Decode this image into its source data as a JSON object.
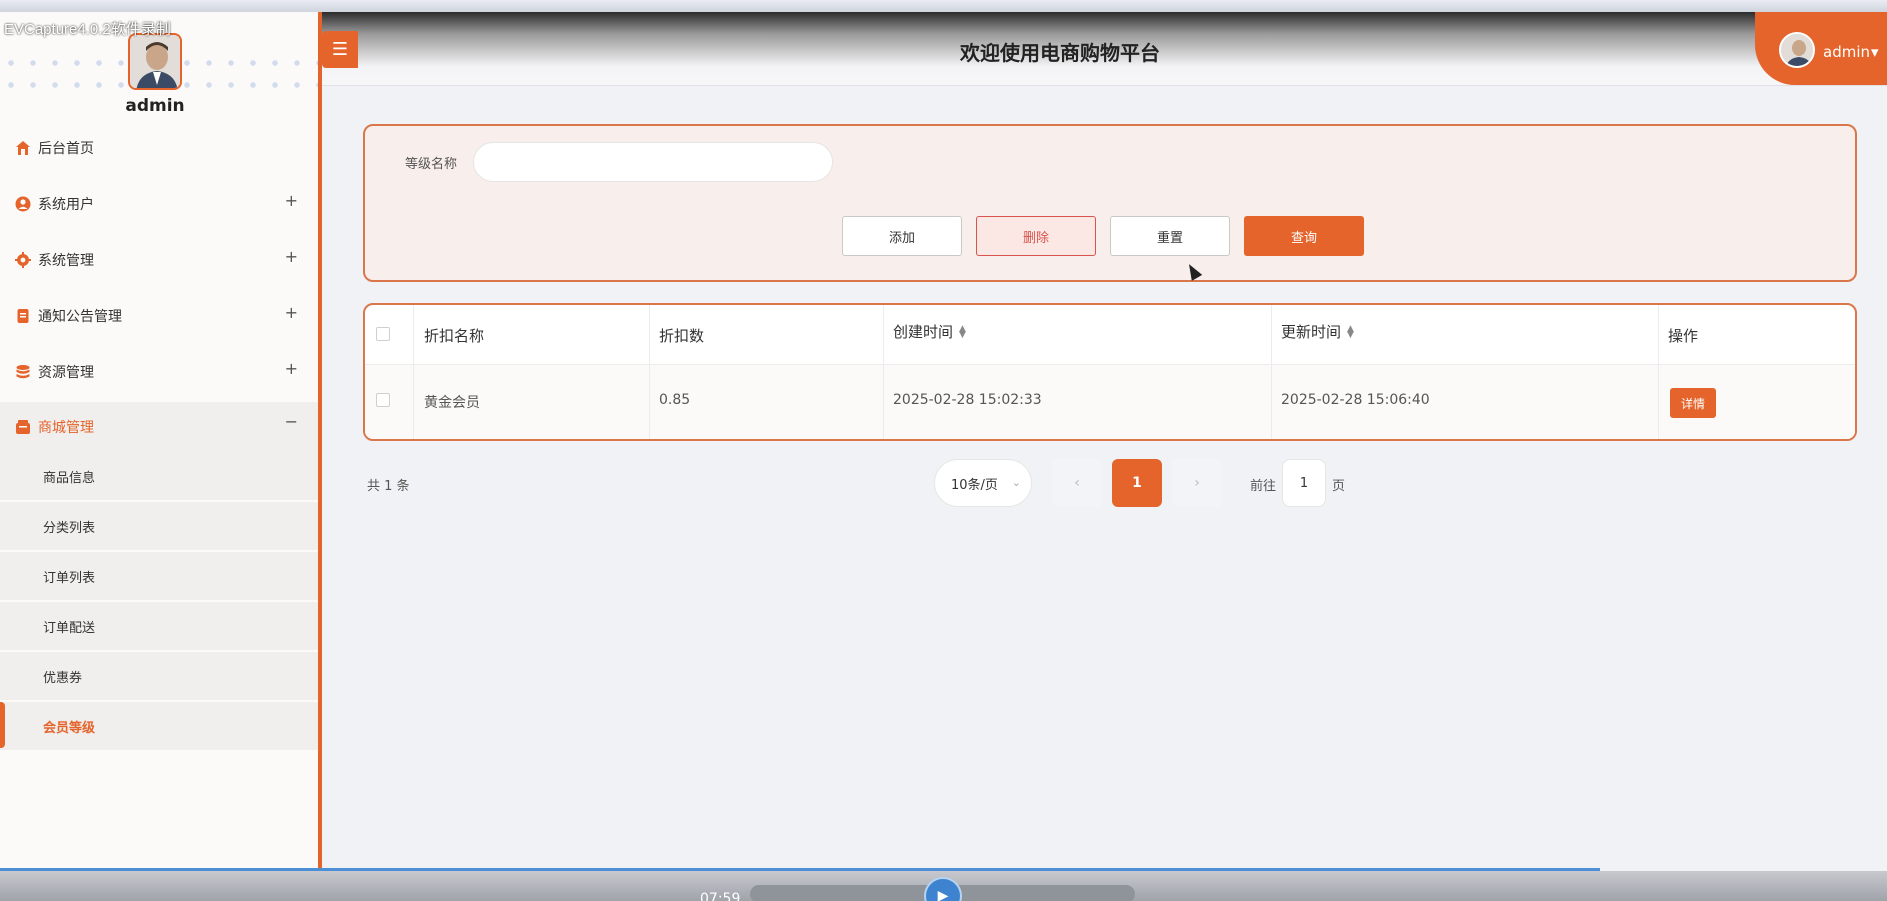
{
  "recorder": {
    "title": "EVCapture4.0.2软件录制"
  },
  "header": {
    "title": "欢迎使用电商购物平台",
    "user_name": "admin",
    "user_chevron": "▾",
    "menu_toggle_icon": "☰"
  },
  "sidebar": {
    "user_name": "admin",
    "items": [
      {
        "label": "后台首页",
        "icon": "home-icon",
        "expand": ""
      },
      {
        "label": "系统用户",
        "icon": "user-icon",
        "expand": "+"
      },
      {
        "label": "系统管理",
        "icon": "gear-icon",
        "expand": "+"
      },
      {
        "label": "通知公告管理",
        "icon": "document-icon",
        "expand": "+"
      },
      {
        "label": "资源管理",
        "icon": "database-icon",
        "expand": "+"
      },
      {
        "label": "商城管理",
        "icon": "store-icon",
        "expand": "−"
      }
    ],
    "sub_items": [
      {
        "label": "商品信息"
      },
      {
        "label": "分类列表"
      },
      {
        "label": "订单列表"
      },
      {
        "label": "订单配送"
      },
      {
        "label": "优惠券"
      },
      {
        "label": "会员等级"
      }
    ],
    "accent_color": "#e4642b"
  },
  "search": {
    "label": "等级名称",
    "value": "",
    "placeholder": "",
    "add_label": "添加",
    "delete_label": "删除",
    "reset_label": "重置",
    "query_label": "查询"
  },
  "table": {
    "columns": [
      "折扣名称",
      "折扣数",
      "创建时间",
      "更新时间",
      "操作"
    ],
    "rows": [
      {
        "name": "黄金会员",
        "discount": "0.85",
        "created": "2025-02-28 15:02:33",
        "updated": "2025-02-28 15:06:40",
        "action": "详情"
      }
    ]
  },
  "pagination": {
    "total": "共 1 条",
    "page_size": "10条/页",
    "prev": "‹",
    "current": "1",
    "next": "›",
    "goto_prefix": "前往",
    "goto_value": "1",
    "goto_suffix": "页"
  },
  "player": {
    "time": "07:59"
  }
}
